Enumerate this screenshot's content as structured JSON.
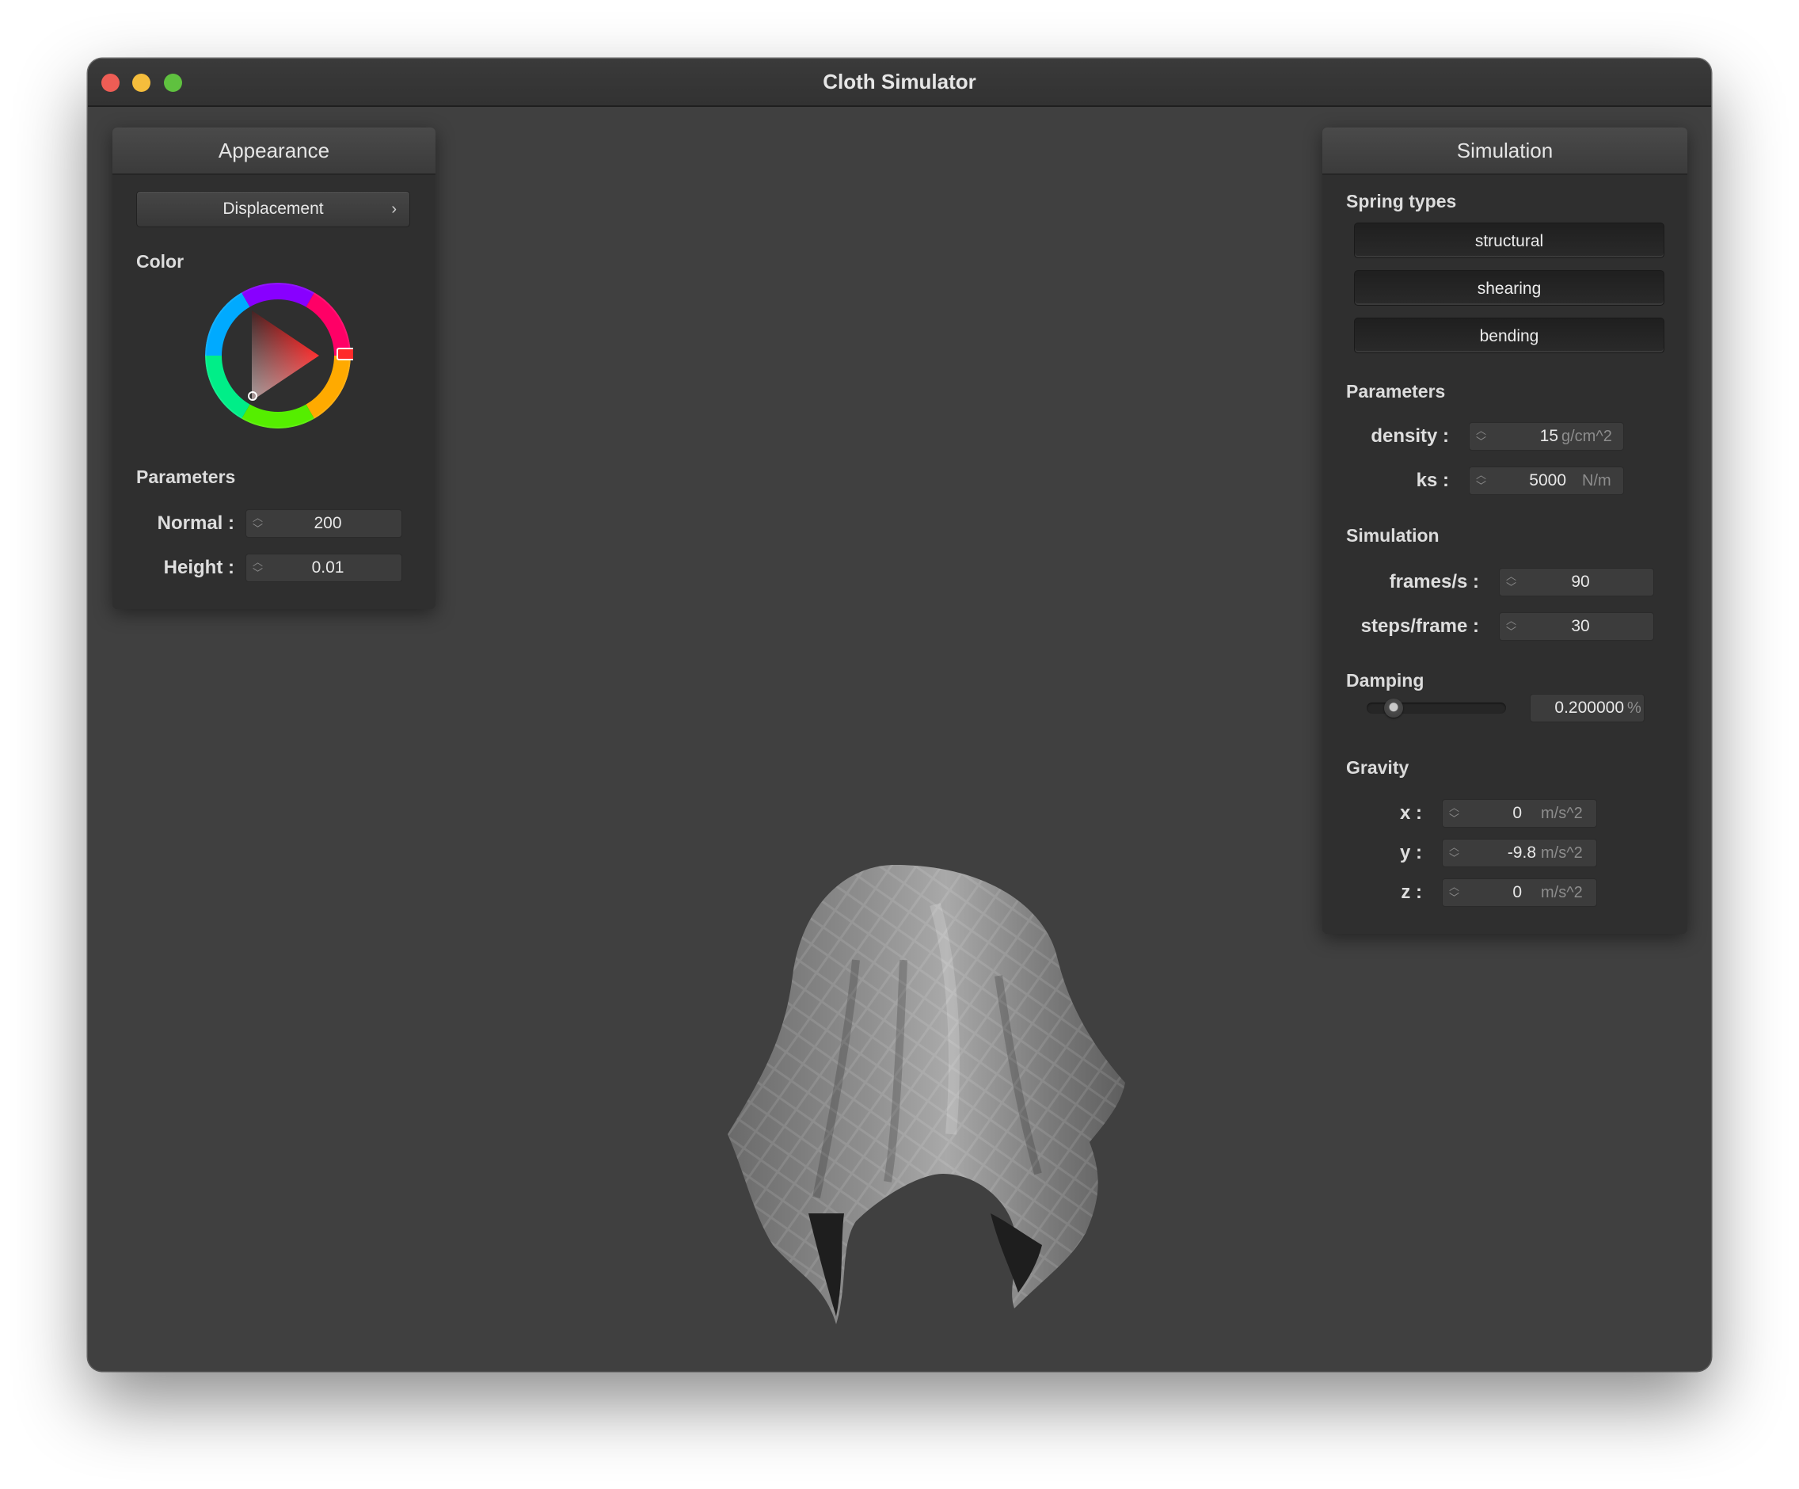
{
  "window": {
    "title": "Cloth Simulator"
  },
  "appearance": {
    "title": "Appearance",
    "shader_dropdown": {
      "value": "Displacement",
      "chevron": "›"
    },
    "color_label": "Color",
    "selected_color": "#ff0000",
    "parameters_label": "Parameters",
    "normal": {
      "label": "Normal :",
      "value": "200"
    },
    "height": {
      "label": "Height :",
      "value": "0.01"
    }
  },
  "simulation": {
    "title": "Simulation",
    "spring_types_label": "Spring types",
    "spring_buttons": [
      "structural",
      "shearing",
      "bending"
    ],
    "parameters_label": "Parameters",
    "density": {
      "label": "density :",
      "value": "15",
      "unit": "g/cm^2"
    },
    "ks": {
      "label": "ks :",
      "value": "5000",
      "unit": "N/m"
    },
    "simulation_label": "Simulation",
    "frames_per_s": {
      "label": "frames/s :",
      "value": "90"
    },
    "steps_per_frame": {
      "label": "steps/frame :",
      "value": "30"
    },
    "damping_label": "Damping",
    "damping": {
      "value": "0.200000",
      "unit": "%",
      "slider_fraction": 0.2
    },
    "gravity_label": "Gravity",
    "gravity": {
      "x": {
        "label": "x :",
        "value": "0",
        "unit": "m/s^2"
      },
      "y": {
        "label": "y :",
        "value": "-9.8",
        "unit": "m/s^2"
      },
      "z": {
        "label": "z :",
        "value": "0",
        "unit": "m/s^2"
      }
    }
  },
  "icons": {
    "spinner": "up-down-chevron-icon",
    "close": "close-traffic-light",
    "minimize": "minimize-traffic-light",
    "maximize": "maximize-traffic-light"
  }
}
